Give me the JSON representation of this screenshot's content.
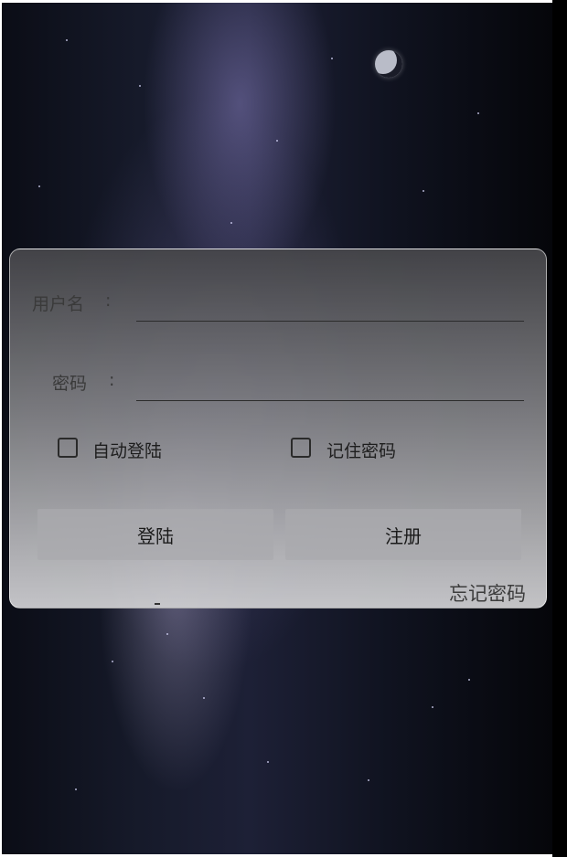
{
  "login": {
    "username_label": "用户名",
    "username_colon": ":",
    "username_value": "",
    "password_label": "密码",
    "password_colon": ":",
    "password_value": "",
    "auto_login_label": "自动登陆",
    "auto_login_checked": false,
    "remember_label": "记住密码",
    "remember_checked": false,
    "login_button": "登陆",
    "register_button": "注册",
    "forgot_password": "忘记密码"
  },
  "colors": {
    "card_top": "#46464a",
    "card_bottom": "#cdcdd0",
    "button_bg": "#aaaaae",
    "background": "#111422"
  }
}
